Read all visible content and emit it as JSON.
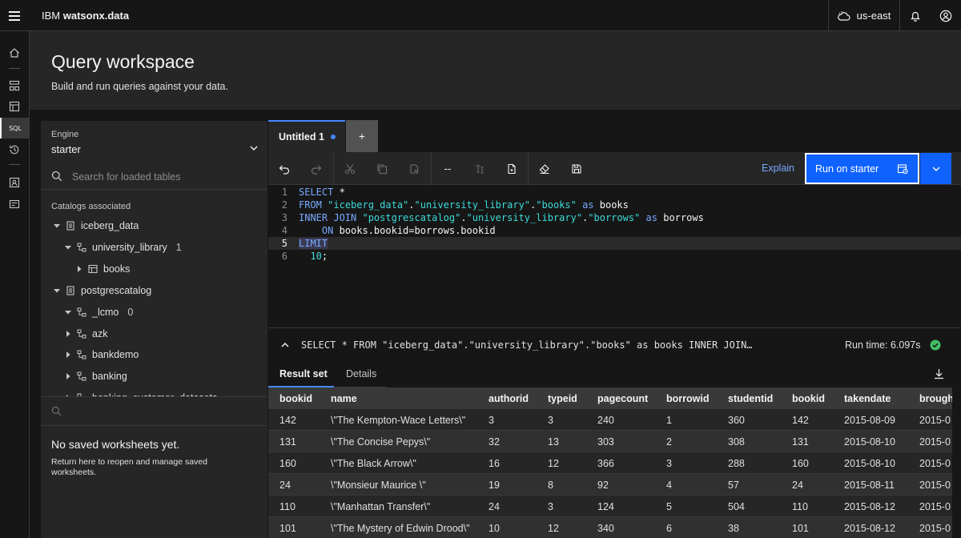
{
  "app": {
    "brand_prefix": "IBM ",
    "brand_name": "watsonx.data",
    "region": "us-east"
  },
  "header": {
    "title": "Query workspace",
    "subtitle": "Build and run queries against your data."
  },
  "nav": {
    "sql_label": "SQL"
  },
  "engine": {
    "label": "Engine",
    "value": "starter"
  },
  "search": {
    "placeholder": "Search for loaded tables"
  },
  "catalogs": {
    "title": "Catalogs associated",
    "nodes": [
      {
        "label": "iceberg_data",
        "count": ""
      },
      {
        "label": "university_library",
        "count": "1"
      },
      {
        "label": "books",
        "count": ""
      },
      {
        "label": "postgrescatalog",
        "count": ""
      },
      {
        "label": "_lcmo",
        "count": "0"
      },
      {
        "label": "azk",
        "count": ""
      },
      {
        "label": "bankdemo",
        "count": ""
      },
      {
        "label": "banking",
        "count": ""
      },
      {
        "label": "banking_customer_datasets",
        "count": ""
      }
    ]
  },
  "worksheets": {
    "empty_title": "No saved worksheets yet.",
    "empty_desc": "Return here to reopen and manage saved worksheets."
  },
  "tabs": {
    "active": "Untitled 1",
    "add": "+"
  },
  "toolbar": {
    "comment": "--",
    "explain": "Explain",
    "run": "Run on starter"
  },
  "editor": {
    "line_numbers": [
      "1",
      "2",
      "3",
      "4",
      "5",
      "6"
    ],
    "l1_kw": "SELECT",
    "l1_rest": " *",
    "l2_kw": "FROM",
    "l2_s1": "\"iceberg_data\"",
    "l2_dot1": ".",
    "l2_s2": "\"university_library\"",
    "l2_dot2": ".",
    "l2_s3": "\"books\"",
    "l2_as": "as",
    "l2_alias": " books",
    "l3_kw": "INNER JOIN",
    "l3_s1": "\"postgrescatalog\"",
    "l3_dot1": ".",
    "l3_s2": "\"university_library\"",
    "l3_dot2": ".",
    "l3_s3": "\"borrows\"",
    "l3_as": "as",
    "l3_alias": " borrows",
    "l4_kw": "ON",
    "l4_rest": " books.bookid=borrows.bookid",
    "l5_kw": "LIMIT",
    "l6_num": "10",
    "l6_rest": ";"
  },
  "summary": {
    "query": "SELECT * FROM \"iceberg_data\".\"university_library\".\"books\" as books INNER JOIN…",
    "runtime": "Run time: 6.097s"
  },
  "results": {
    "tab_result": "Result set",
    "tab_details": "Details",
    "columns": [
      "bookid",
      "name",
      "authorid",
      "typeid",
      "pagecount",
      "borrowid",
      "studentid",
      "bookid",
      "takendate",
      "broughtdate"
    ],
    "rows": [
      [
        "142",
        "\\\"The Kempton-Wace Letters\\\"",
        "3",
        "3",
        "240",
        "1",
        "360",
        "142",
        "2015-08-09",
        "2015-0"
      ],
      [
        "131",
        "\\\"The Concise Pepys\\\"",
        "32",
        "13",
        "303",
        "2",
        "308",
        "131",
        "2015-08-10",
        "2015-0"
      ],
      [
        "160",
        "\\\"The Black Arrow\\\"",
        "16",
        "12",
        "366",
        "3",
        "288",
        "160",
        "2015-08-10",
        "2015-0"
      ],
      [
        "24",
        "\\\"Monsieur Maurice \\\"",
        "19",
        "8",
        "92",
        "4",
        "57",
        "24",
        "2015-08-11",
        "2015-0"
      ],
      [
        "110",
        "\\\"Manhattan Transfer\\\"",
        "24",
        "3",
        "124",
        "5",
        "504",
        "110",
        "2015-08-12",
        "2015-0"
      ],
      [
        "101",
        "\\\"The Mystery of Edwin Drood\\\"",
        "10",
        "12",
        "340",
        "6",
        "38",
        "101",
        "2015-08-12",
        "2015-0"
      ]
    ]
  }
}
